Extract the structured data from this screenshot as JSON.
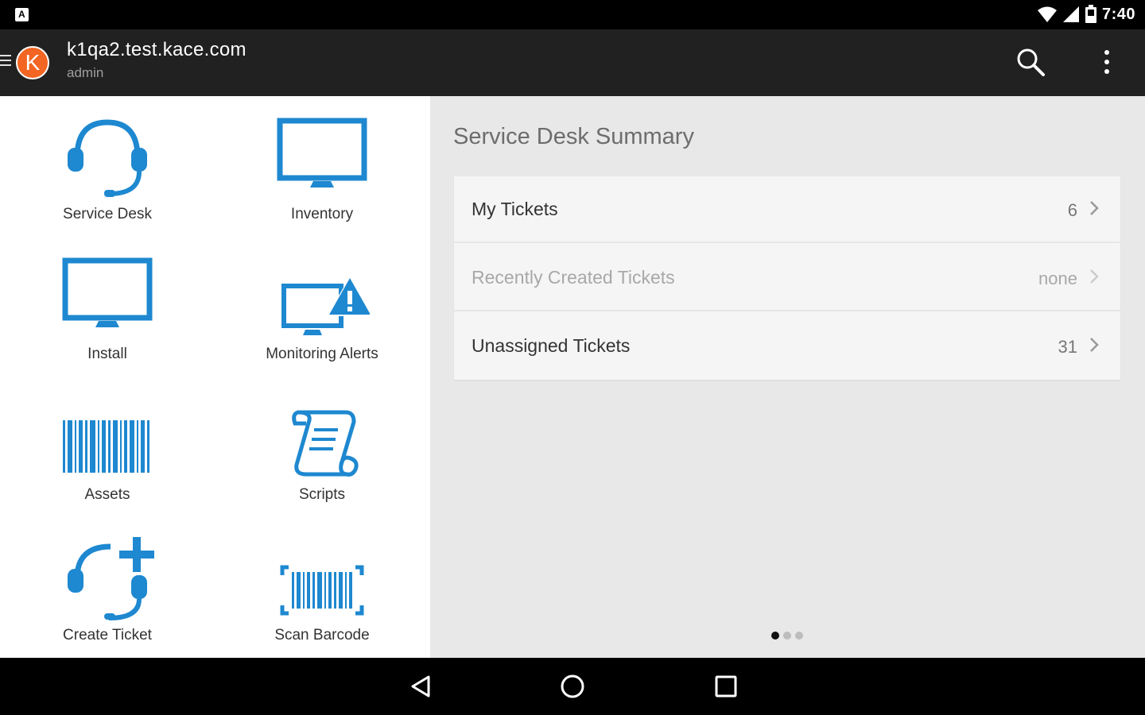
{
  "status_bar": {
    "time": "7:40",
    "icons": [
      "notification-icon",
      "wifi-icon",
      "signal-icon",
      "battery-icon"
    ]
  },
  "app_bar": {
    "host": "k1qa2.test.kace.com",
    "user": "admin",
    "logo_letter": "K",
    "actions": [
      "search-icon",
      "overflow-menu-icon"
    ]
  },
  "tiles": [
    {
      "label": "Service Desk",
      "icon": "headset-icon"
    },
    {
      "label": "Inventory",
      "icon": "monitor-icon"
    },
    {
      "label": "Install",
      "icon": "monitor-icon"
    },
    {
      "label": "Monitoring Alerts",
      "icon": "monitor-alert-icon"
    },
    {
      "label": "Assets",
      "icon": "barcode-icon"
    },
    {
      "label": "Scripts",
      "icon": "scroll-icon"
    },
    {
      "label": "Create Ticket",
      "icon": "headset-plus-icon"
    },
    {
      "label": "Scan Barcode",
      "icon": "scan-barcode-icon"
    }
  ],
  "summary": {
    "title": "Service Desk Summary",
    "rows": [
      {
        "label": "My Tickets",
        "value": "6"
      },
      {
        "label": "Recently Created Tickets",
        "value": "none"
      },
      {
        "label": "Unassigned Tickets",
        "value": "31"
      }
    ]
  },
  "pager": {
    "pages": 3,
    "current": 1
  },
  "colors": {
    "accent_blue": "#1e88d0",
    "brand_orange": "#f26522",
    "app_bar": "#212121"
  }
}
